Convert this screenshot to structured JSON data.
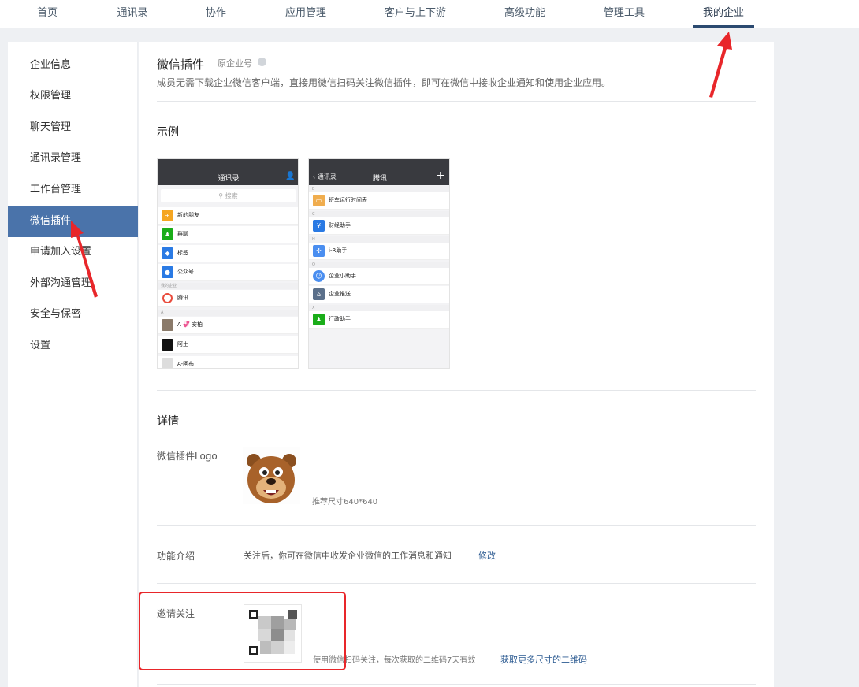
{
  "top_nav": {
    "items": [
      "首页",
      "通讯录",
      "协作",
      "应用管理",
      "客户与上下游",
      "高级功能",
      "管理工具",
      "我的企业"
    ],
    "active_index": 7
  },
  "sidebar": {
    "items": [
      "企业信息",
      "权限管理",
      "聊天管理",
      "通讯录管理",
      "工作台管理",
      "微信插件",
      "申请加入设置",
      "外部沟通管理",
      "安全与保密",
      "设置"
    ],
    "active_index": 5
  },
  "header": {
    "title": "微信插件",
    "subtitle": "原企业号",
    "description": "成员无需下载企业微信客户端，直接用微信扫码关注微信插件，即可在微信中接收企业通知和使用企业应用。"
  },
  "example": {
    "title": "示例",
    "phone1": {
      "title": "通讯录",
      "search_placeholder": "搜索",
      "rows": [
        "新的朋友",
        "群聊",
        "标签",
        "公众号"
      ],
      "section_company": "我的企业",
      "company_row": "腾讯",
      "section_a": "A",
      "contacts": [
        "A 💞 安柏",
        "阿土",
        "A-阿布"
      ]
    },
    "phone2": {
      "back": "通讯录",
      "title": "腾讯",
      "plus": "+",
      "rows": [
        "班车运行时间表",
        "财经助手",
        "i-R助手",
        "企业小助手",
        "企业推送",
        "行政助手"
      ],
      "sections": [
        "B",
        "C",
        "H",
        "Q",
        "X"
      ]
    }
  },
  "details": {
    "title": "详情",
    "logo_label": "微信插件Logo",
    "logo_hint": "推荐尺寸640*640",
    "intro_label": "功能介绍",
    "intro_text": "关注后，你可在微信中收发企业微信的工作消息和通知",
    "edit_link": "修改",
    "invite_label": "邀请关注",
    "invite_hint": "使用微信扫码关注，每次获取的二维码7天有效",
    "more_qr_link": "获取更多尺寸的二维码"
  },
  "colors": {
    "accent": "#4a73aa",
    "annotation_red": "#e8262a",
    "link": "#2b5a91"
  },
  "icons": {
    "info": "info-icon",
    "add_contact": "add-contact-icon",
    "search": "search-icon",
    "mic": "mic-icon"
  }
}
